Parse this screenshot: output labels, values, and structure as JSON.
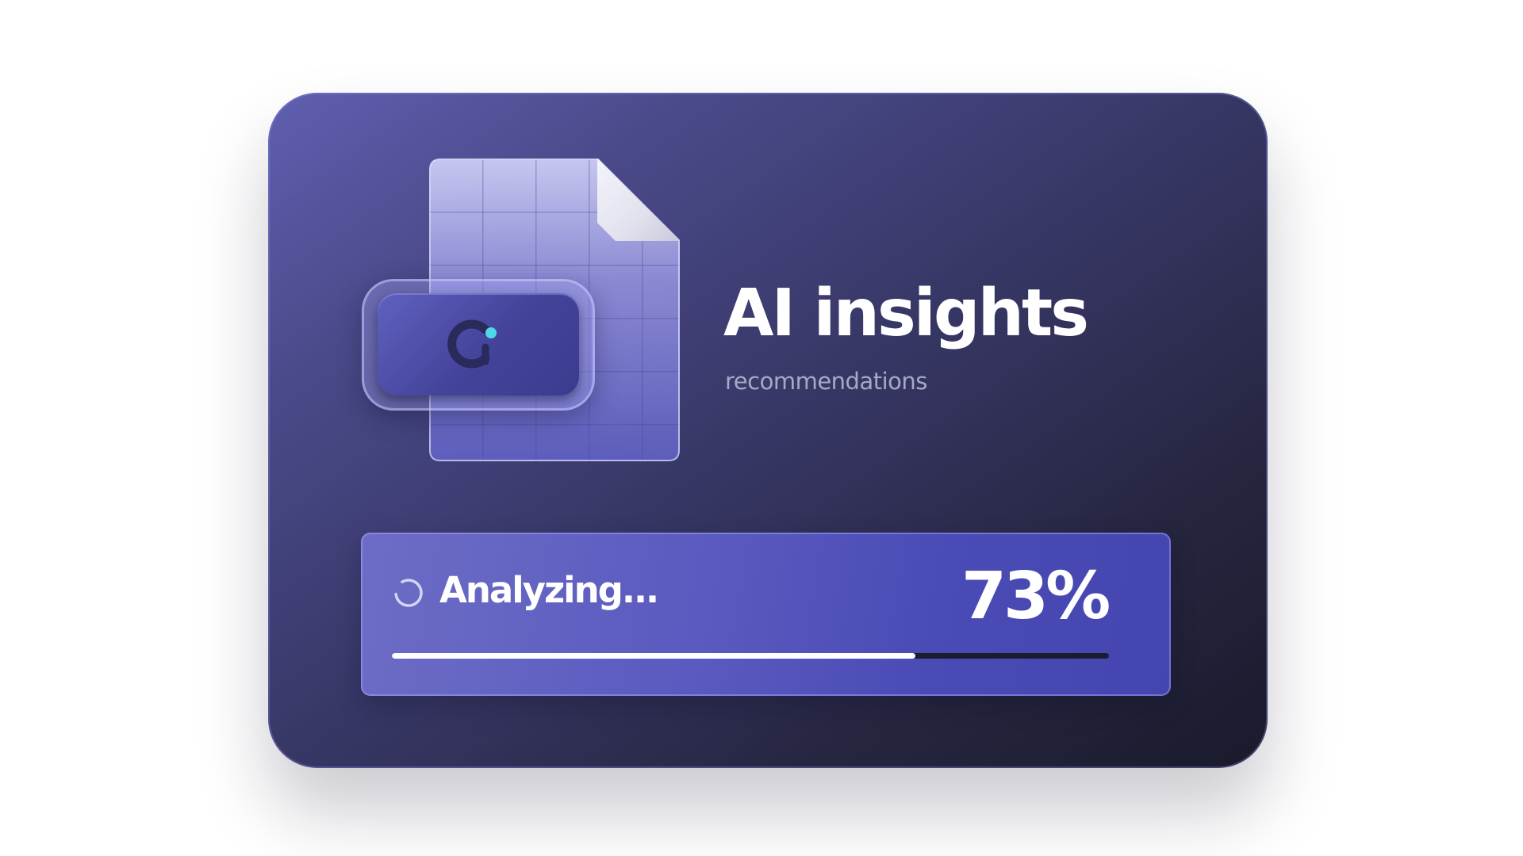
{
  "card": {
    "title": "AI insights",
    "subtitle": "recommendations"
  },
  "illustration": {
    "document_icon": "document-grid-icon",
    "chip_icon": "ai-chip-logo-icon",
    "accent_color": "#4fd8e8"
  },
  "progress": {
    "status_label": "Analyzing...",
    "percent_label": "73%",
    "value": 0.73,
    "spinner_icon": "loading-spinner-icon"
  },
  "colors": {
    "card_gradient_start": "#5f5fb0",
    "card_gradient_end": "#1a1a2c",
    "panel": "#5656bc",
    "track": "#1c1c30",
    "fill": "#ffffff"
  }
}
